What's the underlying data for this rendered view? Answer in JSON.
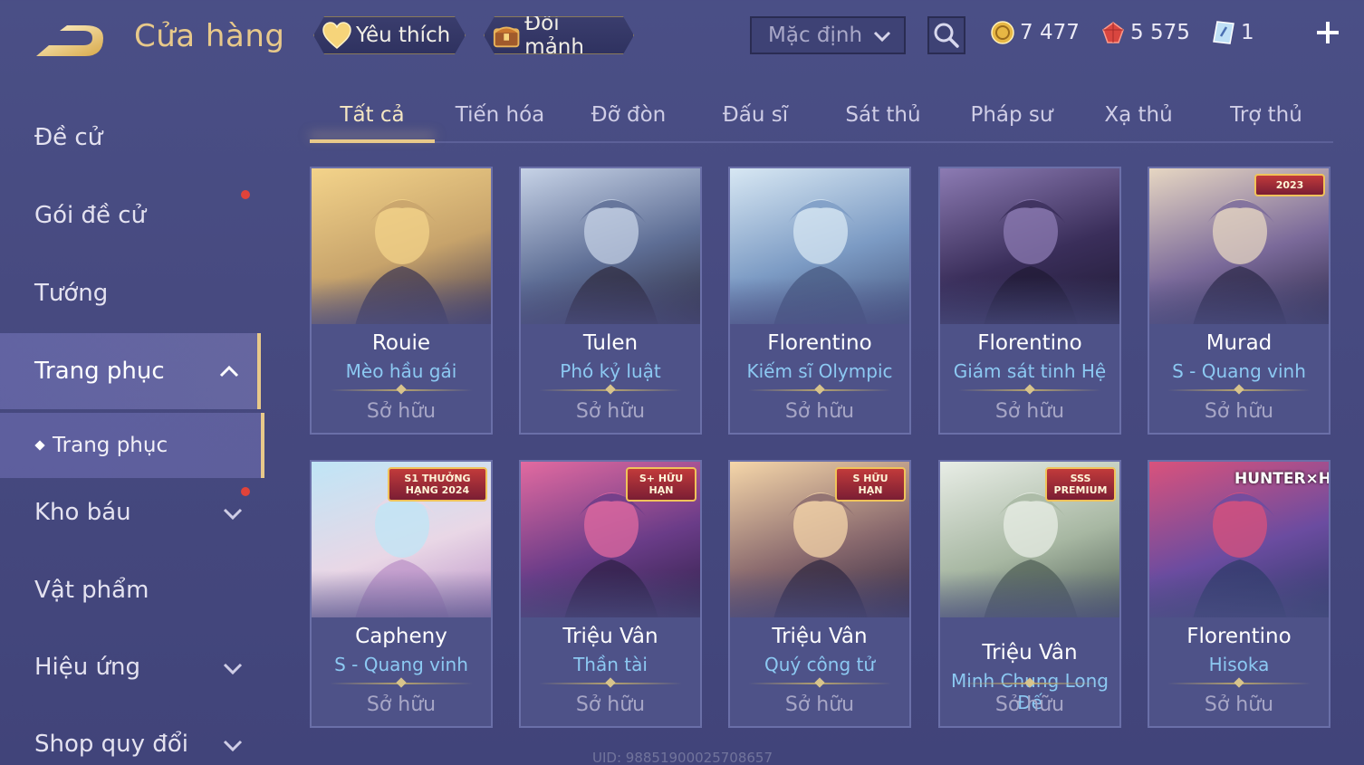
{
  "header": {
    "title": "Cửa hàng",
    "favorite_label": "Yêu thích",
    "exchange_label": "Đổi mảnh",
    "sort_value": "Mặc định",
    "currencies": {
      "gold": "7 477",
      "ruby": "5 575",
      "ticket": "1"
    }
  },
  "sidebar": {
    "items": [
      {
        "label": "Đề cử"
      },
      {
        "label": "Gói đề cử"
      },
      {
        "label": "Tướng"
      },
      {
        "label": "Trang phục"
      },
      {
        "label": "Kho báu"
      },
      {
        "label": "Vật phẩm"
      },
      {
        "label": "Hiệu ứng"
      },
      {
        "label": "Shop quy đổi"
      }
    ],
    "sub_item": "Trang phục"
  },
  "tabs": [
    "Tất cả",
    "Tiến hóa",
    "Đỡ đòn",
    "Đấu sĩ",
    "Sát thủ",
    "Pháp sư",
    "Xạ thủ",
    "Trợ thủ"
  ],
  "cards": [
    {
      "hero": "Rouie",
      "skin": "Mèo hầu gái",
      "status": "Sở hữu",
      "colors": [
        "#f3d38a",
        "#c7a36b",
        "#3b3453"
      ]
    },
    {
      "hero": "Tulen",
      "skin": "Phó kỷ luật",
      "status": "Sở hữu",
      "colors": [
        "#c6d2e6",
        "#5e6e95",
        "#2d2a3d"
      ]
    },
    {
      "hero": "Florentino",
      "skin": "Kiếm sĩ Olympic",
      "status": "Sở hữu",
      "colors": [
        "#d7e7f3",
        "#7c9bc4",
        "#45557e"
      ]
    },
    {
      "hero": "Florentino",
      "skin": "Giám sát tinh Hệ",
      "status": "Sở hữu",
      "colors": [
        "#8c7bb3",
        "#3a2e5a",
        "#1f1a33"
      ]
    },
    {
      "hero": "Murad",
      "skin": "S - Quang vinh",
      "status": "Sở hữu",
      "badge": "2023",
      "colors": [
        "#e6d6c2",
        "#7b6a9a",
        "#2b2847"
      ]
    },
    {
      "hero": "Capheny",
      "skin": "S - Quang vinh",
      "status": "Sở hữu",
      "badge": "S1 THƯỞNG HẠNG 2024",
      "colors": [
        "#bfe5f6",
        "#e9d7e6",
        "#b98fc6"
      ]
    },
    {
      "hero": "Triệu Vân",
      "skin": "Thần tài",
      "status": "Sở hữu",
      "badge": "S+ HỮU HẠN",
      "colors": [
        "#e26aa0",
        "#6a3c88",
        "#2c1f44"
      ]
    },
    {
      "hero": "Triệu Vân",
      "skin": "Quý công tử",
      "status": "Sở hữu",
      "badge": "S HỮU HẠN",
      "colors": [
        "#f5d6a9",
        "#8a6a6e",
        "#2e2640"
      ]
    },
    {
      "hero": "Triệu Vân",
      "skin": "Minh Chung Long Đế",
      "status": "Sở hữu",
      "badge": "SSS PREMIUM",
      "colors": [
        "#e8ede6",
        "#a7b7a2",
        "#4c5b52"
      ]
    },
    {
      "hero": "Florentino",
      "skin": "Hisoka",
      "status": "Sở hữu",
      "badge": "HUNTER×HUNTER",
      "colors": [
        "#d9527c",
        "#6b4ca0",
        "#2c3a66"
      ]
    }
  ],
  "footer": {
    "uid": "UID: 98851900025708657"
  }
}
